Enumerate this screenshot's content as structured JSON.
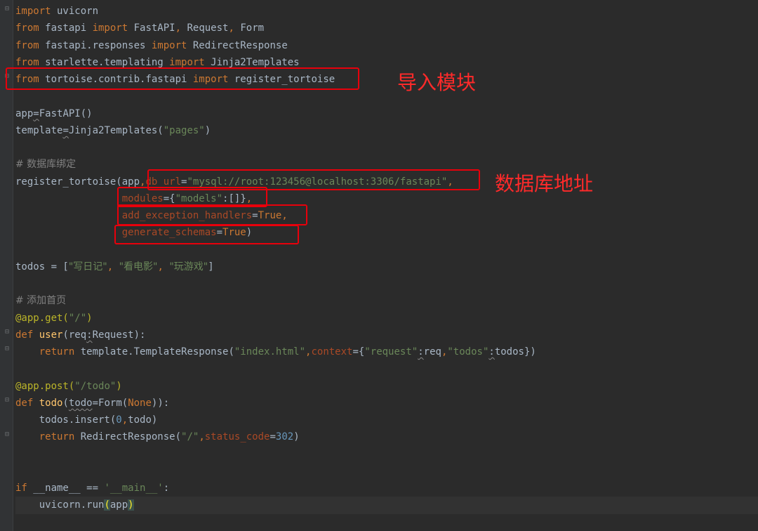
{
  "code_lines": [
    [
      {
        "t": "import",
        "c": "kw"
      },
      {
        "t": " uvicorn"
      }
    ],
    [
      {
        "t": "from",
        "c": "kw"
      },
      {
        "t": " fastapi "
      },
      {
        "t": "import",
        "c": "kw"
      },
      {
        "t": " FastAPI"
      },
      {
        "t": ",",
        "c": "kw"
      },
      {
        "t": " Request"
      },
      {
        "t": ",",
        "c": "kw"
      },
      {
        "t": " Form"
      }
    ],
    [
      {
        "t": "from",
        "c": "kw"
      },
      {
        "t": " fastapi.responses "
      },
      {
        "t": "import",
        "c": "kw"
      },
      {
        "t": " RedirectResponse"
      }
    ],
    [
      {
        "t": "from",
        "c": "kw"
      },
      {
        "t": " starlette.templating "
      },
      {
        "t": "import",
        "c": "kw"
      },
      {
        "t": " Jinja2Templates"
      }
    ],
    [
      {
        "t": "from",
        "c": "kw"
      },
      {
        "t": " tortoise.contrib.fastapi "
      },
      {
        "t": "import",
        "c": "kw"
      },
      {
        "t": " register_tortoise"
      }
    ],
    [],
    [
      {
        "t": "app"
      },
      {
        "t": "=",
        "c": "squig"
      },
      {
        "t": "FastAPI()"
      }
    ],
    [
      {
        "t": "template"
      },
      {
        "t": "=",
        "c": "squig"
      },
      {
        "t": "Jinja2Templates("
      },
      {
        "t": "\"pages\"",
        "c": "str"
      },
      {
        "t": ")"
      }
    ],
    [],
    [
      {
        "t": "# 数据库绑定",
        "c": "cm"
      }
    ],
    [
      {
        "t": "register_tortoise(app"
      },
      {
        "t": ",",
        "c": "kw"
      },
      {
        "t": "db_url",
        "c": "param"
      },
      {
        "t": "="
      },
      {
        "t": "\"mysql://root:123456@localhost:3306/fastapi\"",
        "c": "str"
      },
      {
        "t": ",",
        "c": "kw"
      }
    ],
    [
      {
        "t": "                  "
      },
      {
        "t": "modules",
        "c": "param"
      },
      {
        "t": "={"
      },
      {
        "t": "\"models\"",
        "c": "str"
      },
      {
        "t": ":[]}"
      },
      {
        "t": ",",
        "c": "kw"
      }
    ],
    [
      {
        "t": "                  "
      },
      {
        "t": "add_exception_handlers",
        "c": "param"
      },
      {
        "t": "="
      },
      {
        "t": "True",
        "c": "bool"
      },
      {
        "t": ",",
        "c": "kw"
      }
    ],
    [
      {
        "t": "                  "
      },
      {
        "t": "generate_schemas",
        "c": "param"
      },
      {
        "t": "="
      },
      {
        "t": "True",
        "c": "bool"
      },
      {
        "t": ")"
      }
    ],
    [],
    [
      {
        "t": "todos = ["
      },
      {
        "t": "\"写日记\"",
        "c": "str"
      },
      {
        "t": ", ",
        "c": "kw"
      },
      {
        "t": "\"看电影\"",
        "c": "str"
      },
      {
        "t": ", ",
        "c": "kw"
      },
      {
        "t": "\"玩游戏\"",
        "c": "str"
      },
      {
        "t": "]"
      }
    ],
    [],
    [
      {
        "t": "# 添加首页",
        "c": "cm"
      }
    ],
    [
      {
        "t": "@app.get(",
        "c": "dec"
      },
      {
        "t": "\"/\"",
        "c": "str"
      },
      {
        "t": ")",
        "c": "dec"
      }
    ],
    [
      {
        "t": "def",
        "c": "kw"
      },
      {
        "t": " "
      },
      {
        "t": "user",
        "c": "fn"
      },
      {
        "t": "(req"
      },
      {
        "t": ":",
        "c": "squig"
      },
      {
        "t": "Request):"
      }
    ],
    [
      {
        "t": "    "
      },
      {
        "t": "return",
        "c": "kw"
      },
      {
        "t": " template.TemplateResponse("
      },
      {
        "t": "\"index.html\"",
        "c": "str"
      },
      {
        "t": ",",
        "c": "kw"
      },
      {
        "t": "context",
        "c": "param"
      },
      {
        "t": "={"
      },
      {
        "t": "\"request\"",
        "c": "str"
      },
      {
        "t": ":",
        "c": "squig"
      },
      {
        "t": "req"
      },
      {
        "t": ",",
        "c": "kw"
      },
      {
        "t": "\"todos\"",
        "c": "str"
      },
      {
        "t": ":",
        "c": "squig"
      },
      {
        "t": "todos})"
      }
    ],
    [],
    [
      {
        "t": "@app.post(",
        "c": "dec"
      },
      {
        "t": "\"/todo\"",
        "c": "str"
      },
      {
        "t": ")",
        "c": "dec"
      }
    ],
    [
      {
        "t": "def",
        "c": "kw"
      },
      {
        "t": " "
      },
      {
        "t": "todo",
        "c": "fn"
      },
      {
        "t": "("
      },
      {
        "t": "todo",
        "c": "squig"
      },
      {
        "t": "=Form("
      },
      {
        "t": "None",
        "c": "kw"
      },
      {
        "t": ")):"
      }
    ],
    [
      {
        "t": "    todos.insert("
      },
      {
        "t": "0",
        "c": "num"
      },
      {
        "t": ",",
        "c": "kw"
      },
      {
        "t": "todo)"
      }
    ],
    [
      {
        "t": "    "
      },
      {
        "t": "return",
        "c": "kw"
      },
      {
        "t": " RedirectResponse("
      },
      {
        "t": "\"/\"",
        "c": "str"
      },
      {
        "t": ",",
        "c": "kw"
      },
      {
        "t": "status_code",
        "c": "param"
      },
      {
        "t": "="
      },
      {
        "t": "302",
        "c": "num"
      },
      {
        "t": ")"
      }
    ],
    [],
    [],
    [
      {
        "t": "if",
        "c": "kw"
      },
      {
        "t": " __name__ == "
      },
      {
        "t": "'__main__'",
        "c": "str"
      },
      {
        "t": ":"
      }
    ],
    [
      {
        "t": "    uvicorn.run"
      },
      {
        "t": "(",
        "c": "hl-paren"
      },
      {
        "t": "app",
        "c": "dunder"
      },
      {
        "t": ")",
        "c": "hl-paren"
      }
    ]
  ],
  "current_line": 29,
  "annotations": {
    "import_module": "导入模块",
    "db_address": "数据库地址"
  },
  "colors": {
    "background": "#2b2b2b",
    "keyword": "#cc7832",
    "string": "#6a8759",
    "annotation": "#e8000b"
  }
}
